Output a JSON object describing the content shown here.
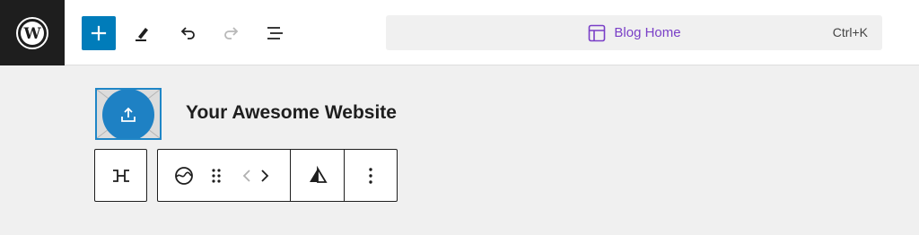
{
  "header": {
    "logo_icon": "wordpress-logo",
    "toolbar": [
      "add-block-icon",
      "edit-pen-icon",
      "undo-icon",
      "redo-icon",
      "list-view-icon"
    ],
    "command_bar": {
      "icon": "layout-template-icon",
      "title": "Blog Home",
      "shortcut": "Ctrl+K"
    }
  },
  "canvas": {
    "site_title": "Your Awesome Website",
    "site_logo_icon": "upload-icon"
  },
  "block_toolbar": {
    "transform_icon": "transform-icon",
    "block_icon": "site-logo-icon",
    "drag_icon": "drag-handle-icon",
    "move_left_icon": "chevron-left-icon",
    "move_right_icon": "chevron-right-icon",
    "align_icon": "align-triangle-icon",
    "options_icon": "more-vertical-icon"
  },
  "colors": {
    "accent": "#007cba",
    "command_title": "#7a3fc7",
    "dark": "#1e1e1e"
  }
}
